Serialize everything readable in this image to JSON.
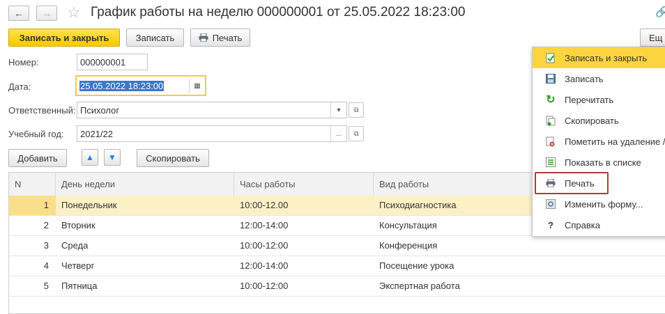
{
  "window": {
    "title": "График работы на неделю 000000001 от 25.05.2022 18:23:00"
  },
  "toolbar": {
    "save_close_label": "Записать и закрыть",
    "save_label": "Записать",
    "print_label": "Печать",
    "more_label": "Ещ"
  },
  "form": {
    "number_label": "Номер:",
    "number_value": "000000001",
    "date_label": "Дата:",
    "date_value": "25.05.2022 18:23:00",
    "responsible_label": "Ответственный:",
    "responsible_value": "Психолог",
    "year_label": "Учебный год:",
    "year_value": "2021/22"
  },
  "table_toolbar": {
    "add_label": "Добавить",
    "copy_label": "Скопировать"
  },
  "table": {
    "columns": [
      "N",
      "День недели",
      "Часы работы",
      "Вид работы"
    ],
    "rows": [
      [
        "1",
        "Понедельник",
        "10:00-12.00",
        "Психодиагностика"
      ],
      [
        "2",
        "Вторник",
        "12:00-14:00",
        "Консультация"
      ],
      [
        "3",
        "Среда",
        "10:00-12:00",
        "Конференция"
      ],
      [
        "4",
        "Четверг",
        "12:00-14:00",
        "Посещение урока"
      ],
      [
        "5",
        "Пятница",
        "10:00-12:00",
        "Экспертная работа"
      ]
    ],
    "selected_row": 0
  },
  "menu": {
    "items": [
      {
        "label": "Записать и закрыть",
        "icon": "save-close-icon"
      },
      {
        "label": "Записать",
        "icon": "floppy-icon"
      },
      {
        "label": "Перечитать",
        "icon": "refresh-icon"
      },
      {
        "label": "Скопировать",
        "icon": "copy-icon"
      },
      {
        "label": "Пометить на удаление /",
        "icon": "delete-mark-icon"
      },
      {
        "label": "Показать в списке",
        "icon": "list-icon"
      },
      {
        "label": "Печать",
        "icon": "printer-icon"
      },
      {
        "label": "Изменить форму...",
        "icon": "form-settings-icon"
      },
      {
        "label": "Справка",
        "icon": "help-icon"
      }
    ],
    "highlighted": "Записать и закрыть",
    "outlined": "Печать"
  },
  "colors": {
    "accent_yellow": "#f5c900",
    "selected_row": "#fcf0c5",
    "selection_blue": "#3a78c9",
    "outline_red": "#b03a3a"
  }
}
